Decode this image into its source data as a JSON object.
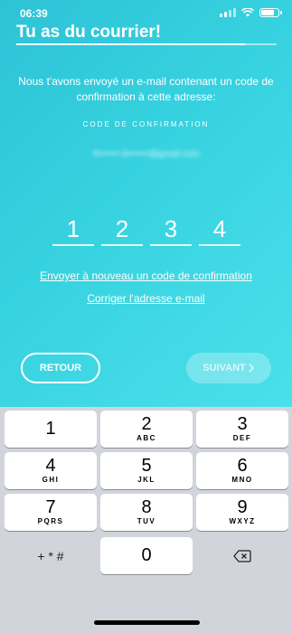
{
  "status": {
    "time": "06:39"
  },
  "header": {
    "title": "Tu as du courrier!",
    "progress_fraction": 0.88
  },
  "main": {
    "intro": "Nous t'avons envoyé un e-mail contenant un code de confirmation à cette adresse:",
    "code_label": "CODE DE CONFIRMATION",
    "email": "th••••••.br••••••@gmail.com",
    "digits": [
      "1",
      "2",
      "3",
      "4"
    ],
    "resend_link": "Envoyer à nouveau un code de confirmation",
    "fix_email_link": "Corriger l'adresse e-mail"
  },
  "buttons": {
    "back": "RETOUR",
    "next": "SUIVANT"
  },
  "keyboard": {
    "keys": [
      {
        "num": "1",
        "letters": ""
      },
      {
        "num": "2",
        "letters": "ABC"
      },
      {
        "num": "3",
        "letters": "DEF"
      },
      {
        "num": "4",
        "letters": "GHI"
      },
      {
        "num": "5",
        "letters": "JKL"
      },
      {
        "num": "6",
        "letters": "MNO"
      },
      {
        "num": "7",
        "letters": "PQRS"
      },
      {
        "num": "8",
        "letters": "TUV"
      },
      {
        "num": "9",
        "letters": "WXYZ"
      },
      {
        "num": "0",
        "letters": ""
      }
    ],
    "symbols_label": "+ * #"
  },
  "colors": {
    "accent_start": "#2cc3d6",
    "accent_end": "#4ae0ea",
    "keyboard_bg": "#d1d5db"
  }
}
